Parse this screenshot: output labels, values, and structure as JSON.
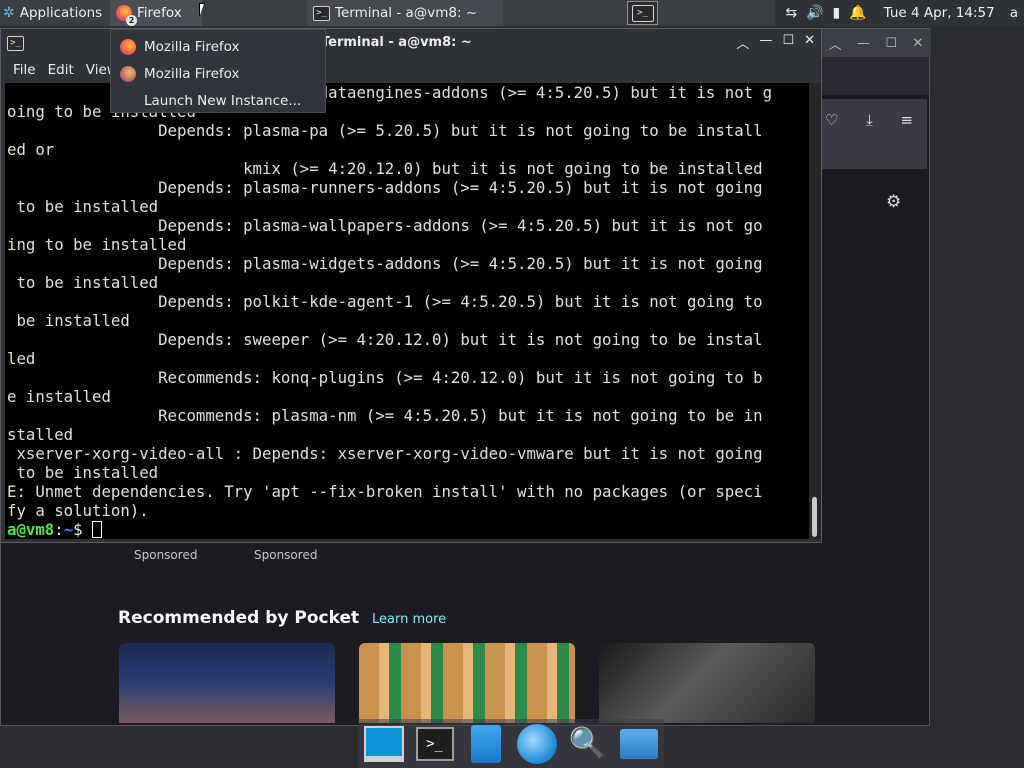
{
  "panel": {
    "applications_label": "Applications",
    "firefox_task_label": "Firefox",
    "firefox_badge": "2",
    "terminal_task_label": "Terminal - a@vm8: ~",
    "clock": "Tue  4 Apr, 14:57",
    "user": "a"
  },
  "firefox_menu": {
    "items": [
      "Mozilla Firefox",
      "Mozilla Firefox",
      "Launch New Instance..."
    ]
  },
  "terminal": {
    "title": "Terminal - a@vm8: ~",
    "menu": [
      "File",
      "Edit",
      "View"
    ],
    "lines": [
      "                 Depends: plasma-dataengines-addons (>= 4:5.20.5) but it is not g",
      "oing to be installed",
      "                Depends: plasma-pa (>= 5.20.5) but it is not going to be install",
      "ed or",
      "                         kmix (>= 4:20.12.0) but it is not going to be installed",
      "                Depends: plasma-runners-addons (>= 4:5.20.5) but it is not going",
      " to be installed",
      "                Depends: plasma-wallpapers-addons (>= 4:5.20.5) but it is not go",
      "ing to be installed",
      "                Depends: plasma-widgets-addons (>= 4:5.20.5) but it is not going",
      " to be installed",
      "                Depends: polkit-kde-agent-1 (>= 4:5.20.5) but it is not going to",
      " be installed",
      "                Depends: sweeper (>= 4:20.12.0) but it is not going to be instal",
      "led",
      "                Recommends: konq-plugins (>= 4:20.12.0) but it is not going to b",
      "e installed",
      "                Recommends: plasma-nm (>= 4:5.20.5) but it is not going to be in",
      "stalled",
      " xserver-xorg-video-all : Depends: xserver-xorg-video-vmware but it is not going",
      " to be installed",
      "E: Unmet dependencies. Try 'apt --fix-broken install' with no packages (or speci",
      "fy a solution)."
    ],
    "prompt_user": "a@vm8",
    "prompt_sep": ":",
    "prompt_path": "~",
    "prompt_sign": "$ "
  },
  "firefox": {
    "sponsored_1": "Sponsored",
    "sponsored_2": "Sponsored",
    "pocket_title": "Recommended by Pocket",
    "learn_more": "Learn more"
  }
}
